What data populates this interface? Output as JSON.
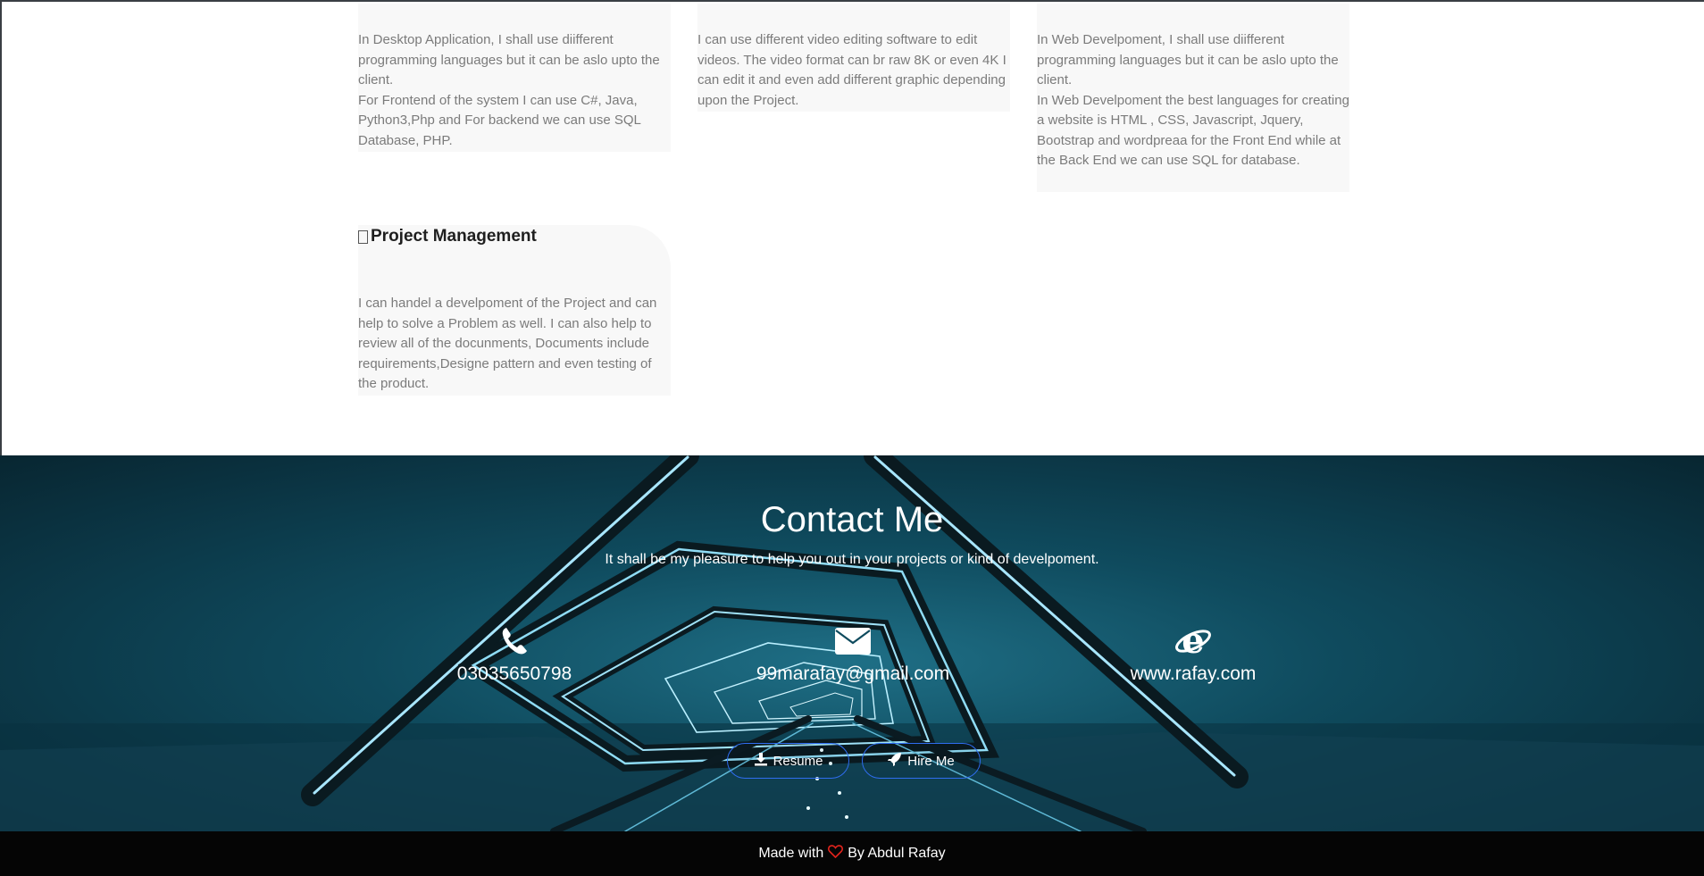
{
  "services": {
    "desktop": {
      "lines": [
        "In Desktop Application, I shall use diifferent programming languages but it can be aslo upto the client.",
        "For Frontend of the system I can use C#, Java, Python3,Php and For backend we can use SQL Database, PHP."
      ]
    },
    "video": {
      "lines": [
        "I can use different video editing software to edit videos. The video format can br raw 8K or even 4K I can edit it and even add different graphic depending upon the Project."
      ]
    },
    "web": {
      "lines": [
        "In Web Develpoment, I shall use diifferent programming languages but it can be aslo upto the client.",
        "In Web Develpoment the best languages for creating a website is HTML , CSS, Javascript, Jquery, Bootstrap and wordpreaa for the Front End while at the Back End we can use SQL for database."
      ]
    },
    "project": {
      "title": "Project Management",
      "body": "I can handel a develpoment of the Project and can help to solve a Problem as well. I can also help to review all of the docunments, Documents include requirements,Designe pattern and even testing of the product."
    }
  },
  "contact": {
    "title": "Contact Me",
    "subtitle": "It shall be my pleasure to help you out in your projects or kind of develpoment.",
    "phone": "03035650798",
    "email": "99marafay@gmail.com",
    "website": "www.rafay.com",
    "resume_label": "Resume",
    "hire_label": "Hire Me"
  },
  "footer": {
    "made_with": "Made with",
    "by": "By Abdul Rafay"
  },
  "icons": {
    "phone": "phone-icon",
    "email": "envelope-icon",
    "web": "internet-explorer-icon",
    "resume": "download-icon",
    "hire": "rocket-icon",
    "heart": "heart-icon"
  },
  "colors": {
    "button_border": "#2f6df0",
    "heart": "#e0231c",
    "footer_bg": "#050505"
  }
}
